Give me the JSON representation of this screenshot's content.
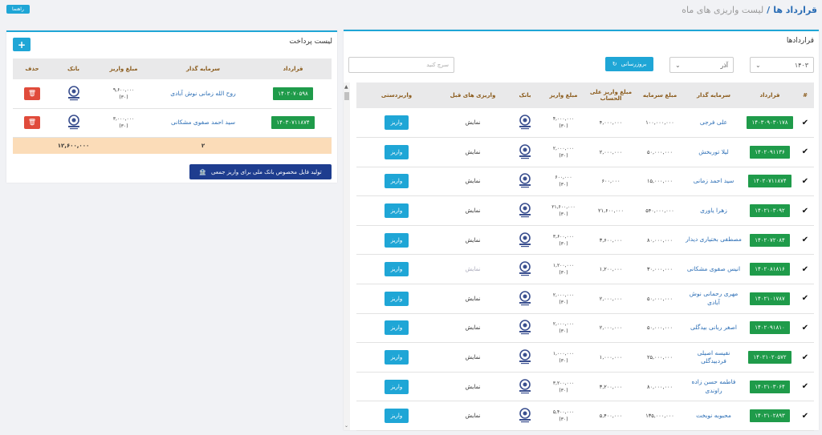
{
  "breadcrumb": {
    "root": "قرارداد ها",
    "separator": "/",
    "current": "لیست واریزی های ماه"
  },
  "help_label": "راهنما",
  "contracts_panel": {
    "title": "قراردادها",
    "year": "۱۴۰۳",
    "month": "آذر",
    "refresh_label": "بروزرسانی",
    "search_placeholder": "سرچ کنید",
    "headers": {
      "check": "#",
      "contract": "قرارداد",
      "investor": "سرمایه گذار",
      "capital": "مبلغ سرمایه",
      "onacct": "مبلغ واریز علی الحساب",
      "deposit": "مبلغ واریز",
      "bank": "بانک",
      "prev": "واریزی های قبل",
      "manual": "واریزدستی"
    },
    "rows": [
      {
        "contract": "۱۴۰۳۰۹۰۳۰۱۷۸",
        "investor": "علی فرجی",
        "capital": "۱۰۰,۰۰۰,۰۰۰",
        "onacct": "۴,۰۰۰,۰۰۰",
        "deposit": "۴,۰۰۰,۰۰۰",
        "days": "(۳۰)",
        "prev": "نمایش",
        "prev_muted": false,
        "pay": "واریز"
      },
      {
        "contract": "۱۴۰۲۰۹۱۱۳۶",
        "investor": "لیلا توربخش",
        "capital": "۵۰,۰۰۰,۰۰۰",
        "onacct": "۲,۰۰۰,۰۰۰",
        "deposit": "۲,۰۰۰,۰۰۰",
        "days": "(۳۰)",
        "prev": "نمایش",
        "prev_muted": false,
        "pay": "واریز"
      },
      {
        "contract": "۱۴۰۲۰۷۱۱۸۷۴",
        "investor": "سید احمد زمانی",
        "capital": "۱۵,۰۰۰,۰۰۰",
        "onacct": "۶۰۰,۰۰۰",
        "deposit": "۶۰۰,۰۰۰",
        "days": "(۳۰)",
        "prev": "نمایش",
        "prev_muted": false,
        "pay": "واریز"
      },
      {
        "contract": "۱۴۰۲۱۰۳۰۹۲",
        "investor": "زهرا یاوری",
        "capital": "۵۴۰,۰۰۰,۰۰۰",
        "onacct": "۲۱,۶۰۰,۰۰۰",
        "deposit": "۲۱,۶۰۰,۰۰۰",
        "days": "(۳۰)",
        "prev": "نمایش",
        "prev_muted": false,
        "pay": "واریز"
      },
      {
        "contract": "۱۴۰۲۰۷۲۰۸۴",
        "investor": "مصطفی بختیاری دیدار",
        "capital": "۸۰,۰۰۰,۰۰۰",
        "onacct": "۳,۶۰۰,۰۰۰",
        "deposit": "۳,۶۰۰,۰۰۰",
        "days": "(۳۰)",
        "prev": "نمایش",
        "prev_muted": false,
        "pay": "واریز"
      },
      {
        "contract": "۱۴۰۲۰۸۱۸۱۶",
        "investor": "انیس صفوی مشکانی",
        "capital": "۳۰,۰۰۰,۰۰۰",
        "onacct": "۱,۲۰۰,۰۰۰",
        "deposit": "۱,۲۰۰,۰۰۰",
        "days": "(۳۰)",
        "prev": "نمایش",
        "prev_muted": true,
        "pay": "واریز"
      },
      {
        "contract": "۱۴۰۲۱۰۱۷۸۷",
        "investor": "مهری رحمانی نوش آبادی",
        "capital": "۵۰,۰۰۰,۰۰۰",
        "onacct": "۲,۰۰۰,۰۰۰",
        "deposit": "۲,۰۰۰,۰۰۰",
        "days": "(۳۰)",
        "prev": "نمایش",
        "prev_muted": false,
        "pay": "واریز"
      },
      {
        "contract": "۱۴۰۲۰۹۱۸۱۰",
        "investor": "اصغر ربانی بیدگلی",
        "capital": "۵۰,۰۰۰,۰۰۰",
        "onacct": "۲,۰۰۰,۰۰۰",
        "deposit": "۲,۰۰۰,۰۰۰",
        "days": "(۳۰)",
        "prev": "نمایش",
        "prev_muted": false,
        "pay": "واریز"
      },
      {
        "contract": "۱۴۰۲۱۰۲۰۵۷۲",
        "investor": "نفیسه اصیلی فردبیدگلی",
        "capital": "۲۵,۰۰۰,۰۰۰",
        "onacct": "۱,۰۰۰,۰۰۰",
        "deposit": "۱,۰۰۰,۰۰۰",
        "days": "(۳۰)",
        "prev": "نمایش",
        "prev_muted": false,
        "pay": "واریز"
      },
      {
        "contract": "۱۴۰۲۱۰۳۰۶۴",
        "investor": "فاطمه حسن زاده راوندی",
        "capital": "۸۰,۰۰۰,۰۰۰",
        "onacct": "۳,۲۰۰,۰۰۰",
        "deposit": "۳,۲۰۰,۰۰۰",
        "days": "(۳۰)",
        "prev": "نمایش",
        "prev_muted": false,
        "pay": "واریز"
      },
      {
        "contract": "۱۴۰۲۱۰۲۸۹۳",
        "investor": "محبوبه نوبخت",
        "capital": "۱۳۵,۰۰۰,۰۰۰",
        "onacct": "۵,۴۰۰,۰۰۰",
        "deposit": "۵,۴۰۰,۰۰۰",
        "days": "(۳۰)",
        "prev": "نمایش",
        "prev_muted": false,
        "pay": "واریز"
      }
    ]
  },
  "payments_panel": {
    "title": "لیست پرداخت",
    "add_label": "+",
    "headers": {
      "contract": "قرارداد",
      "investor": "سرمایه گذار",
      "deposit": "مبلغ واریز",
      "bank": "بانک",
      "delete": "حذف"
    },
    "rows": [
      {
        "contract": "۱۴۰۲۰۷۰۵۹۸",
        "investor": "روح الله زمانی نوش آبادی",
        "deposit": "۹,۶۰۰,۰۰۰",
        "days": "(۳۰)"
      },
      {
        "contract": "۱۴۰۳۰۷۱۱۸۷۴",
        "investor": "سید احمد صفوی مشکانی",
        "deposit": "۳,۰۰۰,۰۰۰",
        "days": "(۳۰)"
      }
    ],
    "total_count": "۲",
    "total_amount": "۱۲,۶۰۰,۰۰۰",
    "generate_label": "تولید فایل مخصوص بانک ملی برای واریز جمعی"
  },
  "colors": {
    "accent": "#1fa6d6",
    "contract_tag": "#1f9b4a",
    "delete": "#e04b3b",
    "total_row": "#fbdcb8",
    "header_text": "#8a5a1a",
    "generate_btn": "#1e3d8f"
  },
  "icons": {
    "bank": "bank-melli-logo-icon",
    "check": "checkmark-icon",
    "refresh": "refresh-icon",
    "trash": "trash-icon",
    "bank_building": "bank-building-icon"
  }
}
